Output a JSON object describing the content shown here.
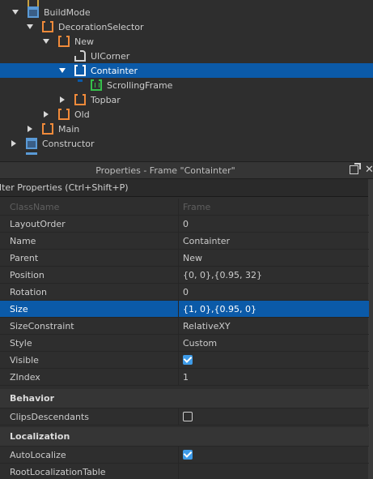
{
  "explorer": {
    "items": [
      {
        "label": "BuildMode",
        "icon": "screen-gui-icon"
      },
      {
        "label": "DecorationSelector",
        "icon": "frame-icon"
      },
      {
        "label": "New",
        "icon": "frame-icon"
      },
      {
        "label": "UICorner",
        "icon": "ui-corner-icon"
      },
      {
        "label": "Containter",
        "icon": "frame-icon"
      },
      {
        "label": "ScrollingFrame",
        "icon": "scrolling-frame-icon"
      },
      {
        "label": "Topbar",
        "icon": "frame-icon"
      },
      {
        "label": "Old",
        "icon": "frame-icon"
      },
      {
        "label": "Main",
        "icon": "frame-icon"
      },
      {
        "label": "Constructor",
        "icon": "screen-gui-icon"
      }
    ]
  },
  "properties": {
    "title": "Properties - Frame \"Containter\"",
    "filter_placeholder": "ilter Properties (Ctrl+Shift+P)",
    "rows": [
      {
        "name": "ClassName",
        "value": "Frame"
      },
      {
        "name": "LayoutOrder",
        "value": "0"
      },
      {
        "name": "Name",
        "value": "Containter"
      },
      {
        "name": "Parent",
        "value": "New"
      },
      {
        "name": "Position",
        "value": "{0, 0},{0.95, 32}"
      },
      {
        "name": "Rotation",
        "value": "0"
      },
      {
        "name": "Size",
        "value": "{1, 0},{0.95, 0}"
      },
      {
        "name": "SizeConstraint",
        "value": "RelativeXY"
      },
      {
        "name": "Style",
        "value": "Custom"
      },
      {
        "name": "Visible",
        "value": true
      },
      {
        "name": "ZIndex",
        "value": "1"
      }
    ],
    "sections": {
      "behavior": "Behavior",
      "localization": "Localization"
    },
    "behavior_rows": [
      {
        "name": "ClipsDescendants",
        "value": false
      }
    ],
    "localization_rows": [
      {
        "name": "AutoLocalize",
        "value": true
      },
      {
        "name": "RootLocalizationTable",
        "value": ""
      }
    ]
  },
  "colors": {
    "selection": "#0b5aa8",
    "frame_icon": "#f08a3a",
    "scrolling_icon": "#35c14b",
    "checkbox": "#3e9be8"
  }
}
